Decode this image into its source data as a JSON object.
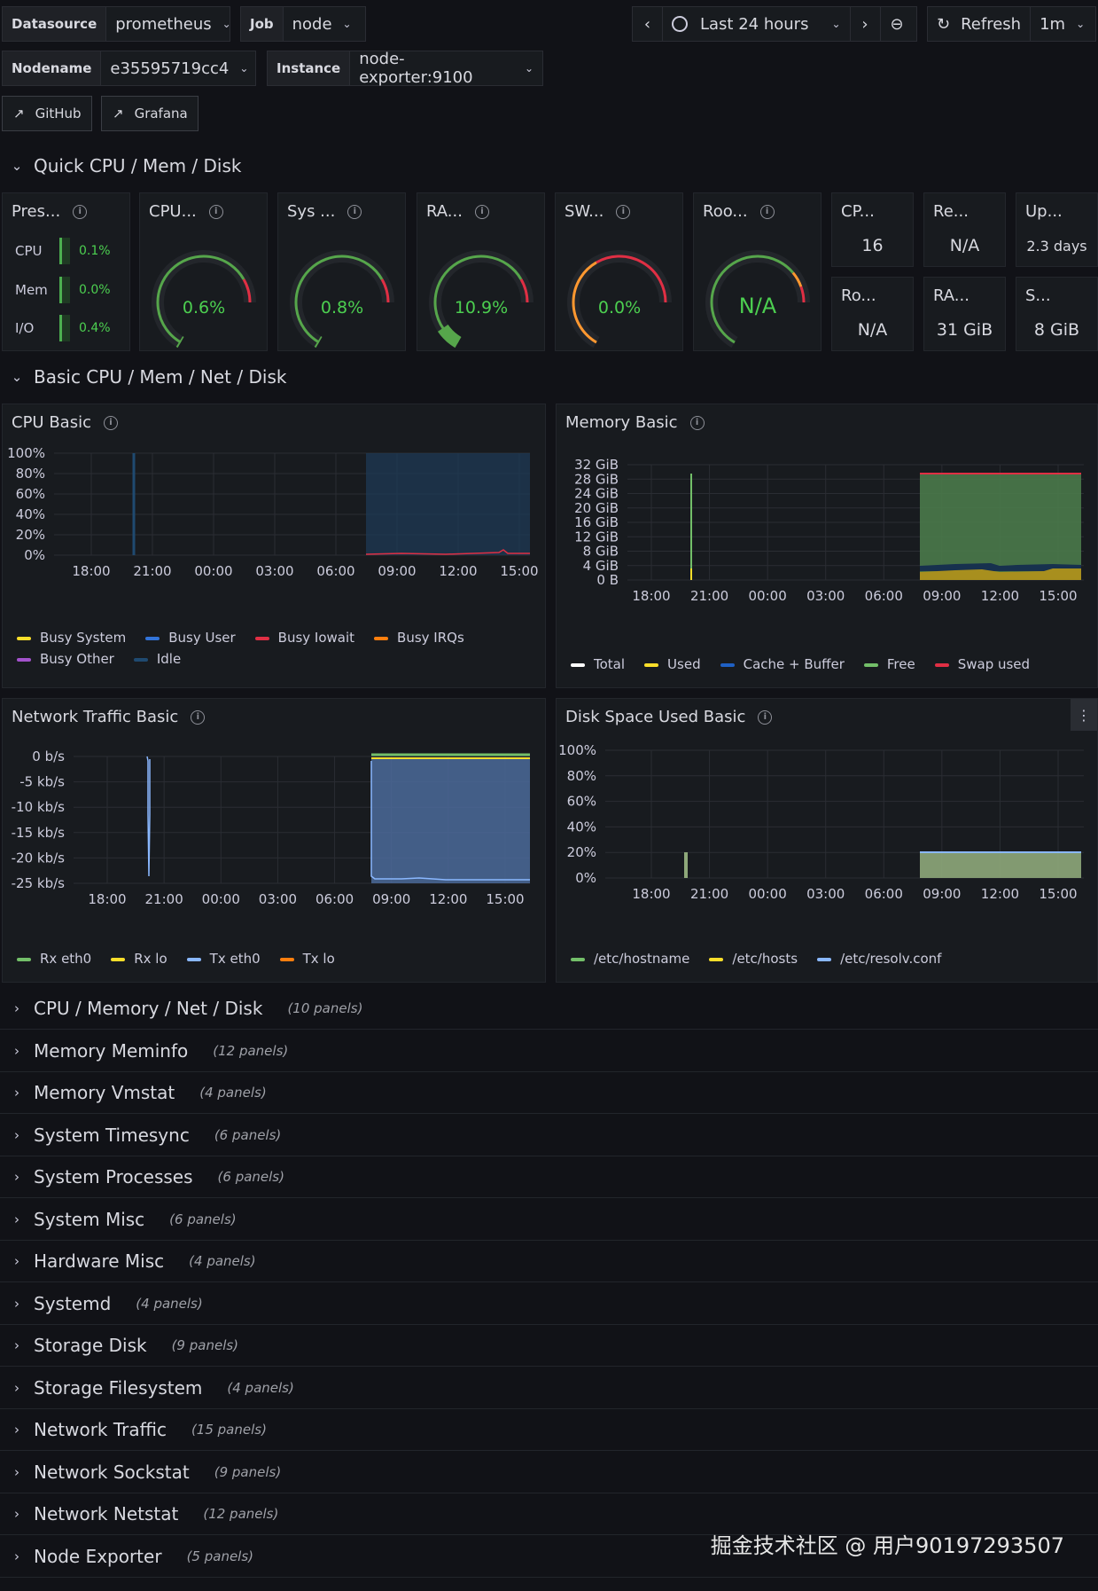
{
  "header": {
    "datasource_label": "Datasource",
    "datasource_value": "prometheus",
    "job_label": "Job",
    "job_value": "node",
    "nodename_label": "Nodename",
    "nodename_value": "e35595719cc4",
    "instance_label": "Instance",
    "instance_value": "node-exporter:9100",
    "time_range": "Last 24 hours",
    "refresh_label": "Refresh",
    "refresh_interval": "1m",
    "github_label": "GitHub",
    "grafana_label": "Grafana"
  },
  "sections": {
    "quick": "Quick CPU / Mem / Disk",
    "basic": "Basic CPU / Mem / Net / Disk"
  },
  "quick": {
    "pressure": {
      "title": "Pres...",
      "rows": [
        {
          "label": "CPU",
          "value": "0.1%"
        },
        {
          "label": "Mem",
          "value": "0.0%"
        },
        {
          "label": "I/O",
          "value": "0.4%"
        }
      ]
    },
    "gauges": [
      {
        "title": "CPU...",
        "value": "0.6%",
        "pct": 0.006
      },
      {
        "title": "Sys ...",
        "value": "0.8%",
        "pct": 0.008
      },
      {
        "title": "RA...",
        "value": "10.9%",
        "pct": 0.109
      },
      {
        "title": "SW...",
        "value": "0.0%",
        "pct": 0.0
      },
      {
        "title": "Roo...",
        "value": "N/A",
        "pct": 0.0
      }
    ],
    "stats": [
      {
        "title": "CP...",
        "value": "16"
      },
      {
        "title": "Re...",
        "value": "N/A"
      },
      {
        "title": "Up...",
        "value": "2.3 days"
      },
      {
        "title": "Ro...",
        "value": "N/A"
      },
      {
        "title": "RA...",
        "value": "31 GiB"
      },
      {
        "title": "S...",
        "value": "8 GiB"
      }
    ]
  },
  "panels": {
    "cpu": {
      "title": "CPU Basic",
      "yticks": [
        "100%",
        "80%",
        "60%",
        "40%",
        "20%",
        "0%"
      ],
      "xticks": [
        "18:00",
        "21:00",
        "00:00",
        "03:00",
        "06:00",
        "09:00",
        "12:00",
        "15:00"
      ],
      "legend": [
        {
          "name": "Busy System",
          "color": "#fade2a"
        },
        {
          "name": "Busy User",
          "color": "#3274d9"
        },
        {
          "name": "Busy Iowait",
          "color": "#e02f44"
        },
        {
          "name": "Busy IRQs",
          "color": "#ff7f0e"
        },
        {
          "name": "Busy Other",
          "color": "#a352cc"
        },
        {
          "name": "Idle",
          "color": "#1f4a70"
        }
      ]
    },
    "memory": {
      "title": "Memory Basic",
      "yticks": [
        "32 GiB",
        "28 GiB",
        "24 GiB",
        "20 GiB",
        "16 GiB",
        "12 GiB",
        "8 GiB",
        "4 GiB",
        "0 B"
      ],
      "xticks": [
        "18:00",
        "21:00",
        "00:00",
        "03:00",
        "06:00",
        "09:00",
        "12:00",
        "15:00"
      ],
      "legend": [
        {
          "name": "Total",
          "color": "#ffffff"
        },
        {
          "name": "Used",
          "color": "#fade2a"
        },
        {
          "name": "Cache + Buffer",
          "color": "#1f60c4"
        },
        {
          "name": "Free",
          "color": "#73bf69"
        },
        {
          "name": "Swap used",
          "color": "#e02f44"
        }
      ]
    },
    "network": {
      "title": "Network Traffic Basic",
      "yticks": [
        "0 b/s",
        "-5 kb/s",
        "-10 kb/s",
        "-15 kb/s",
        "-20 kb/s",
        "-25 kb/s"
      ],
      "xticks": [
        "18:00",
        "21:00",
        "00:00",
        "03:00",
        "06:00",
        "09:00",
        "12:00",
        "15:00"
      ],
      "legend": [
        {
          "name": "Rx eth0",
          "color": "#73bf69"
        },
        {
          "name": "Rx lo",
          "color": "#fade2a"
        },
        {
          "name": "Tx eth0",
          "color": "#8ab8ff"
        },
        {
          "name": "Tx lo",
          "color": "#ff7f0e"
        }
      ]
    },
    "disk": {
      "title": "Disk Space Used Basic",
      "yticks": [
        "100%",
        "80%",
        "60%",
        "40%",
        "20%",
        "0%"
      ],
      "xticks": [
        "18:00",
        "21:00",
        "00:00",
        "03:00",
        "06:00",
        "09:00",
        "12:00",
        "15:00"
      ],
      "legend": [
        {
          "name": "/etc/hostname",
          "color": "#73bf69"
        },
        {
          "name": "/etc/hosts",
          "color": "#fade2a"
        },
        {
          "name": "/etc/resolv.conf",
          "color": "#8ab8ff"
        }
      ]
    }
  },
  "collapsed_rows": [
    {
      "title": "CPU / Memory / Net / Disk",
      "count": "(10 panels)"
    },
    {
      "title": "Memory Meminfo",
      "count": "(12 panels)"
    },
    {
      "title": "Memory Vmstat",
      "count": "(4 panels)"
    },
    {
      "title": "System Timesync",
      "count": "(6 panels)"
    },
    {
      "title": "System Processes",
      "count": "(6 panels)"
    },
    {
      "title": "System Misc",
      "count": "(6 panels)"
    },
    {
      "title": "Hardware Misc",
      "count": "(4 panels)"
    },
    {
      "title": "Systemd",
      "count": "(4 panels)"
    },
    {
      "title": "Storage Disk",
      "count": "(9 panels)"
    },
    {
      "title": "Storage Filesystem",
      "count": "(4 panels)"
    },
    {
      "title": "Network Traffic",
      "count": "(15 panels)"
    },
    {
      "title": "Network Sockstat",
      "count": "(9 panels)"
    },
    {
      "title": "Network Netstat",
      "count": "(12 panels)"
    },
    {
      "title": "Node Exporter",
      "count": "(5 panels)"
    }
  ],
  "watermark": "掘金技术社区 @ 用户90197293507"
}
